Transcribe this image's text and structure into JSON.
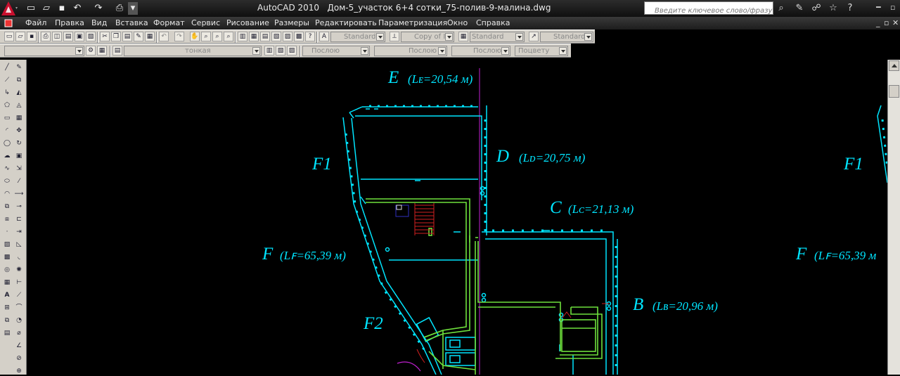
{
  "window": {
    "app_name": "AutoCAD 2010",
    "file_name": "Дом-5_участок 6+4 сотки_75-полив-9-малина.dwg",
    "search_placeholder": "Введите ключевое слово/фразу"
  },
  "menu": [
    "Файл",
    "Правка",
    "Вид",
    "Вставка",
    "Формат",
    "Сервис",
    "Рисование",
    "Размеры",
    "Редактировать",
    "Параметризация",
    "Окно",
    "Справка"
  ],
  "styles_toolbar": {
    "text_style": "Standard",
    "dim_style": "Copy of IS",
    "table_style": "Standard",
    "mleader_style": "Standard"
  },
  "layers_toolbar": {
    "layer_name": "тонкая"
  },
  "properties_toolbar": {
    "color": "Послою",
    "linetype": "Послою",
    "lineweight": "Послою",
    "plotstyle": "Поцвету"
  },
  "drawing": {
    "labels": {
      "E": "E",
      "E_len": "(Lᴇ=20,54  м)",
      "D": "D",
      "D_len": "(Lᴅ=20,75  м)",
      "C": "C",
      "C_len": "(Lᴄ=21,13  м)",
      "B": "B",
      "B_len": "(Lʙ=20,96  м)",
      "F": "F",
      "F_len": "(Lꜰ=65,39  м)",
      "F1": "F1",
      "F2": "F2",
      "F1_right": "F1",
      "F_right": "F",
      "F_len_right": "(Lꜰ=65,39  м"
    },
    "colors": {
      "boundary": "#00e5ff",
      "house_walls": "#6ee03c",
      "stairs": "#d02020",
      "axis": "#c020d0"
    }
  }
}
